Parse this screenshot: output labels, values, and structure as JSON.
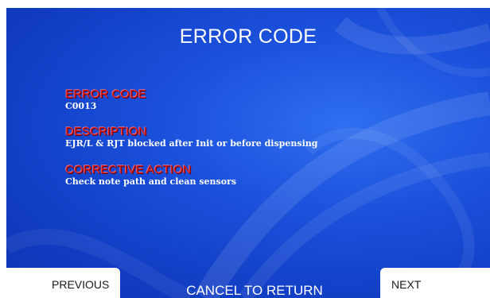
{
  "screen": {
    "title": "ERROR CODE",
    "fields": [
      {
        "label": "ERROR CODE",
        "value": "C0013"
      },
      {
        "label": "DESCRIPTION",
        "value": "EJR/L & RJT blocked after Init or before dispensing"
      },
      {
        "label": "CORRECTIVE ACTION",
        "value": "Check note path and clean sensors"
      }
    ]
  },
  "buttons": {
    "previous": "PREVIOUS",
    "cancel": "CANCEL TO RETURN",
    "next": "NEXT"
  },
  "colors": {
    "background": "#1c52dd",
    "label_red": "#e21a1a",
    "text_white": "#ffffff"
  }
}
